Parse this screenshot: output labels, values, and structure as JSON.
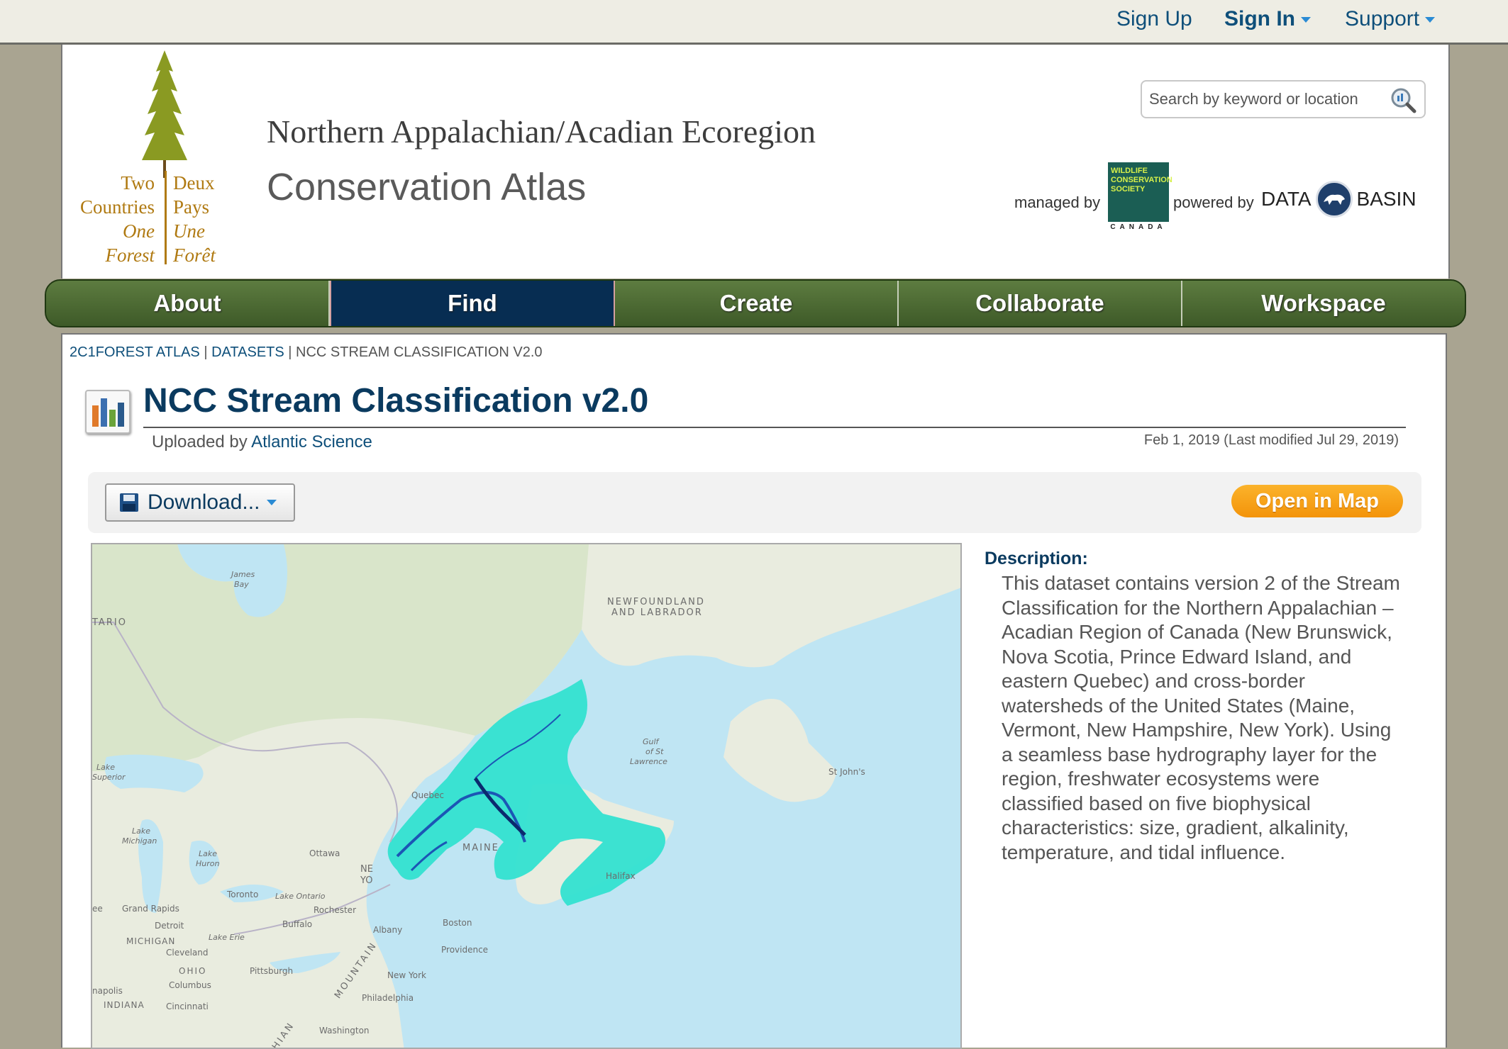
{
  "topbar": {
    "sign_up": "Sign Up",
    "sign_in": "Sign In",
    "support": "Support"
  },
  "header": {
    "tagline_left": [
      "Two",
      "Countries",
      "One",
      "Forest"
    ],
    "tagline_right": [
      "Deux",
      "Pays",
      "Une",
      "Forêt"
    ],
    "title": "Northern Appalachian/Acadian Ecoregion",
    "subtitle": "Conservation Atlas",
    "search_placeholder": "Search by keyword or location",
    "managed_by": "managed by",
    "wcs_logo_text": "WILDLIFE CONSERVATION SOCIETY",
    "wcs_country": "CANADA",
    "powered_by": "powered by",
    "databasin_left": "DATA",
    "databasin_right": "BASIN"
  },
  "nav": {
    "items": [
      {
        "label": "About",
        "active": false
      },
      {
        "label": "Find",
        "active": true
      },
      {
        "label": "Create",
        "active": false
      },
      {
        "label": "Collaborate",
        "active": false
      },
      {
        "label": "Workspace",
        "active": false
      }
    ]
  },
  "breadcrumb": {
    "items": [
      "2C1FOREST ATLAS",
      "DATASETS"
    ],
    "current": "NCC STREAM CLASSIFICATION V2.0",
    "separator": "|"
  },
  "dataset": {
    "title": "NCC Stream Classification v2.0",
    "uploaded_prefix": "Uploaded by",
    "uploader": "Atlantic Science",
    "dates": "Feb 1, 2019 (Last modified Jul 29, 2019)",
    "download_label": "Download...",
    "open_map_label": "Open in Map",
    "description_label": "Description:",
    "description": "This dataset contains version 2 of the Stream Classification for the Northern Appalachian – Acadian Region of Canada (New Brunswick, Nova Scotia, Prince Edward Island, and eastern Quebec) and cross-border watersheds of the United States (Maine, Vermont, New Hampshire, New York). Using a seamless base hydrography layer for the region, freshwater ecosystems were classified based on five biophysical characteristics: size, gradient, alkalinity, temperature, and tidal influence."
  },
  "map": {
    "labels": {
      "james_bay_1": "James",
      "james_bay_2": "Bay",
      "ontario": "TARIO",
      "newfoundland_1": "NEWFOUNDLAND",
      "newfoundland_2": "AND LABRADOR",
      "gulf_1": "Gulf",
      "gulf_2": "of St",
      "gulf_3": "Lawrence",
      "st_johns": "St John's",
      "lake_superior_1": "Lake",
      "lake_superior_2": "Superior",
      "quebec": "Quebec",
      "lake_michigan_1": "Lake",
      "lake_michigan_2": "Michigan",
      "lake_huron_1": "Lake",
      "lake_huron_2": "Huron",
      "ottawa": "Ottawa",
      "maine": "MAINE",
      "ny_1": "NE",
      "ny_2": "YO",
      "halifax": "Halifax",
      "toronto": "Toronto",
      "lake_ontario": "Lake Ontario",
      "rochester": "Rochester",
      "grand_rapids": "Grand Rapids",
      "detroit": "Detroit",
      "buffalo": "Buffalo",
      "albany": "Albany",
      "boston": "Boston",
      "lake_erie": "Lake Erie",
      "michigan": "MICHIGAN",
      "cleveland": "Cleveland",
      "providence": "Providence",
      "ohio": "OHIO",
      "pittsburgh": "Pittsburgh",
      "new_york": "New York",
      "columbus": "Columbus",
      "indianapolis": "napolis",
      "indiana": "INDIANA",
      "cincinnati": "Cincinnati",
      "philadelphia": "Philadelphia",
      "washington": "Washington",
      "mountains": "MOUNTAIN",
      "chian": "CHIAN",
      "ee": "ee"
    },
    "colors": {
      "land": "#e9ecdf",
      "forest": "#d5e4c4",
      "water": "#bfe5f3",
      "stream_layer": "#33e2d0",
      "stream_dark": "#1b56b5"
    }
  }
}
